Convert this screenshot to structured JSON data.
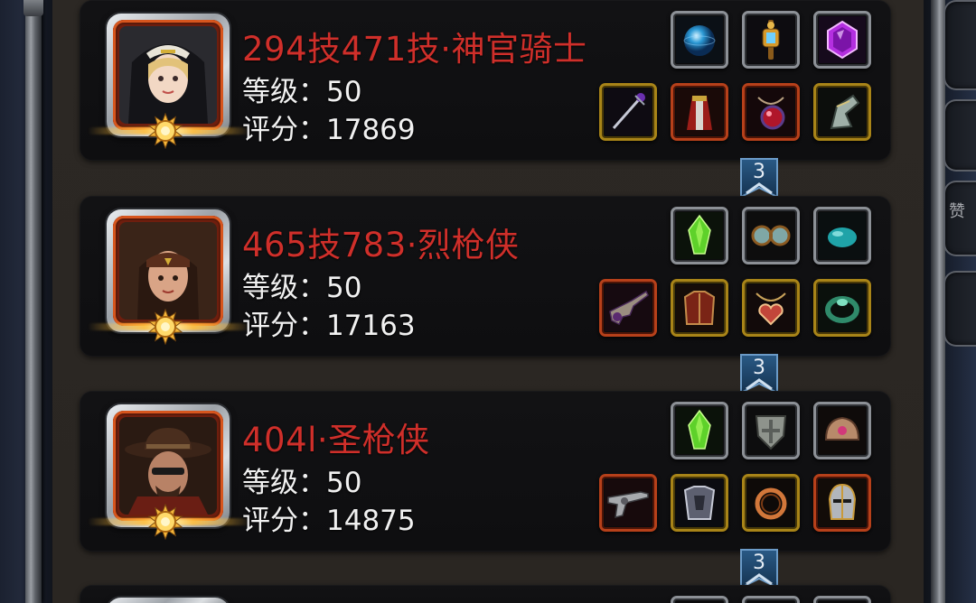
{
  "side_tab_label": "赞",
  "characters": [
    {
      "name": "294技471技·神官骑士",
      "level_text": "等级：50",
      "score_text": "评分：17869",
      "portrait": "nun-portrait",
      "top_slots": [
        {
          "icon": "blue-orb-icon",
          "frame": "silver"
        },
        {
          "icon": "golden-lantern-icon",
          "frame": "silver"
        },
        {
          "icon": "purple-gem-icon",
          "frame": "silver"
        }
      ],
      "bottom_slots": [
        {
          "icon": "staff-weapon-icon",
          "frame": "gold"
        },
        {
          "icon": "red-robe-icon",
          "frame": "red"
        },
        {
          "icon": "crimson-amulet-icon",
          "frame": "red"
        },
        {
          "icon": "gauntlet-icon",
          "frame": "gold"
        }
      ],
      "badge_count": "3"
    },
    {
      "name": "465技783·烈枪侠",
      "level_text": "等级：50",
      "score_text": "评分：17163",
      "portrait": "bandana-gunner-portrait",
      "top_slots": [
        {
          "icon": "green-crystal-icon",
          "frame": "silver"
        },
        {
          "icon": "goggles-icon",
          "frame": "silver"
        },
        {
          "icon": "teal-stone-icon",
          "frame": "silver"
        }
      ],
      "bottom_slots": [
        {
          "icon": "pistol-blade-icon",
          "frame": "red"
        },
        {
          "icon": "leather-armor-icon",
          "frame": "gold"
        },
        {
          "icon": "heart-necklace-icon",
          "frame": "gold"
        },
        {
          "icon": "jade-ring-icon",
          "frame": "gold"
        }
      ],
      "badge_count": "3"
    },
    {
      "name": "404l·圣枪侠",
      "level_text": "等级：50",
      "score_text": "评分：14875",
      "portrait": "cowboy-gunner-portrait",
      "top_slots": [
        {
          "icon": "green-crystal-icon",
          "frame": "silver"
        },
        {
          "icon": "cross-shield-icon",
          "frame": "silver"
        },
        {
          "icon": "shoulder-pad-icon",
          "frame": "silver"
        }
      ],
      "bottom_slots": [
        {
          "icon": "revolver-icon",
          "frame": "red"
        },
        {
          "icon": "plate-armor-icon",
          "frame": "gold"
        },
        {
          "icon": "copper-ring-icon",
          "frame": "gold"
        },
        {
          "icon": "knight-helmet-icon",
          "frame": "red"
        }
      ],
      "badge_count": "3"
    }
  ],
  "colors": {
    "name_red": "#cf2f2a",
    "stat_white": "#f1f1f1",
    "frame_gold": "#a88418",
    "frame_red": "#b6401a",
    "frame_silver": "#8c9096",
    "badge_blue": "#1f4a72"
  }
}
